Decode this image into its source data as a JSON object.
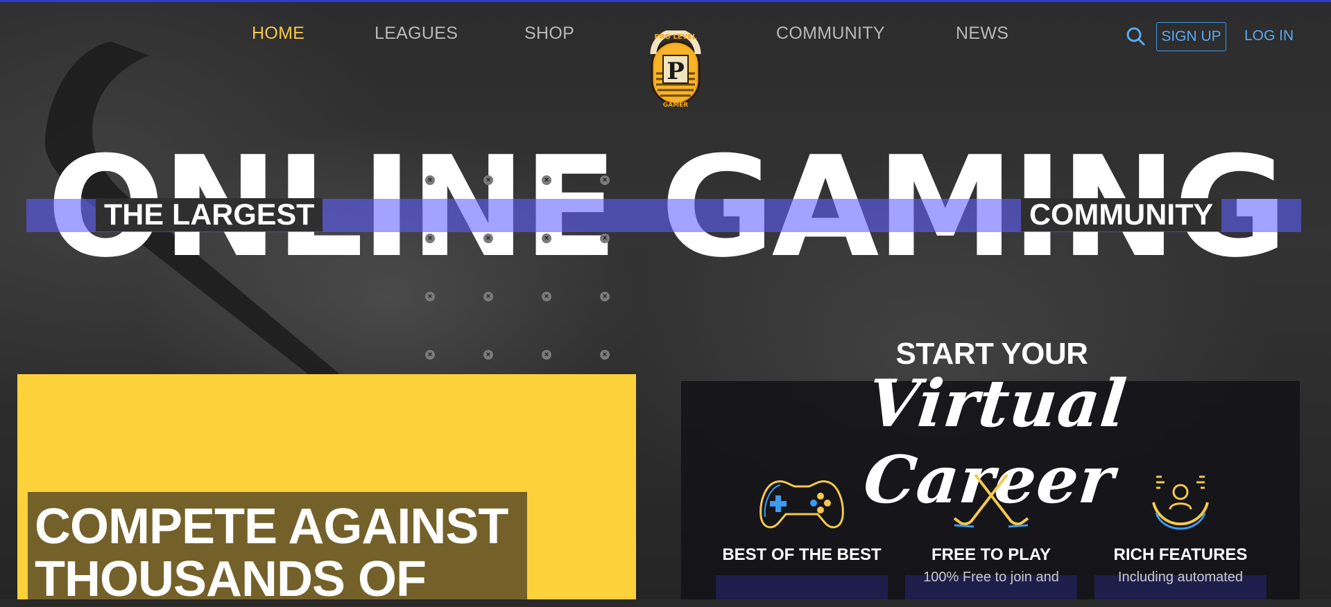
{
  "nav": {
    "left": [
      "HOME",
      "LEAGUES",
      "SHOP"
    ],
    "right": [
      "COMMUNITY",
      "NEWS"
    ],
    "signup": "SIGN UP",
    "login": "LOG IN"
  },
  "logo": {
    "top_text": "PRO LEVEL",
    "letter": "P",
    "bottom_text": "GAMER"
  },
  "hero": {
    "title": "ONLINE GAMING",
    "tag_left": "THE LARGEST",
    "tag_right": "COMMUNITY"
  },
  "left_card": {
    "headline": "COMPETE AGAINST THOUSANDS OF"
  },
  "right_panel": {
    "start": "START YOUR",
    "career": "Virtual Career",
    "features": [
      {
        "icon": "gamepad-icon",
        "title": "BEST OF THE BEST",
        "desc": ""
      },
      {
        "icon": "hockey-sticks-icon",
        "title": "FREE TO PLAY",
        "desc": "100% Free to join and"
      },
      {
        "icon": "features-icon",
        "title": "RICH FEATURES",
        "desc": "Including automated"
      }
    ]
  },
  "colors": {
    "accent_yellow": "#fdd13a",
    "nav_active": "#f5c94a",
    "link_blue": "#5aaaf2",
    "band_blue": "#5f5fff"
  }
}
